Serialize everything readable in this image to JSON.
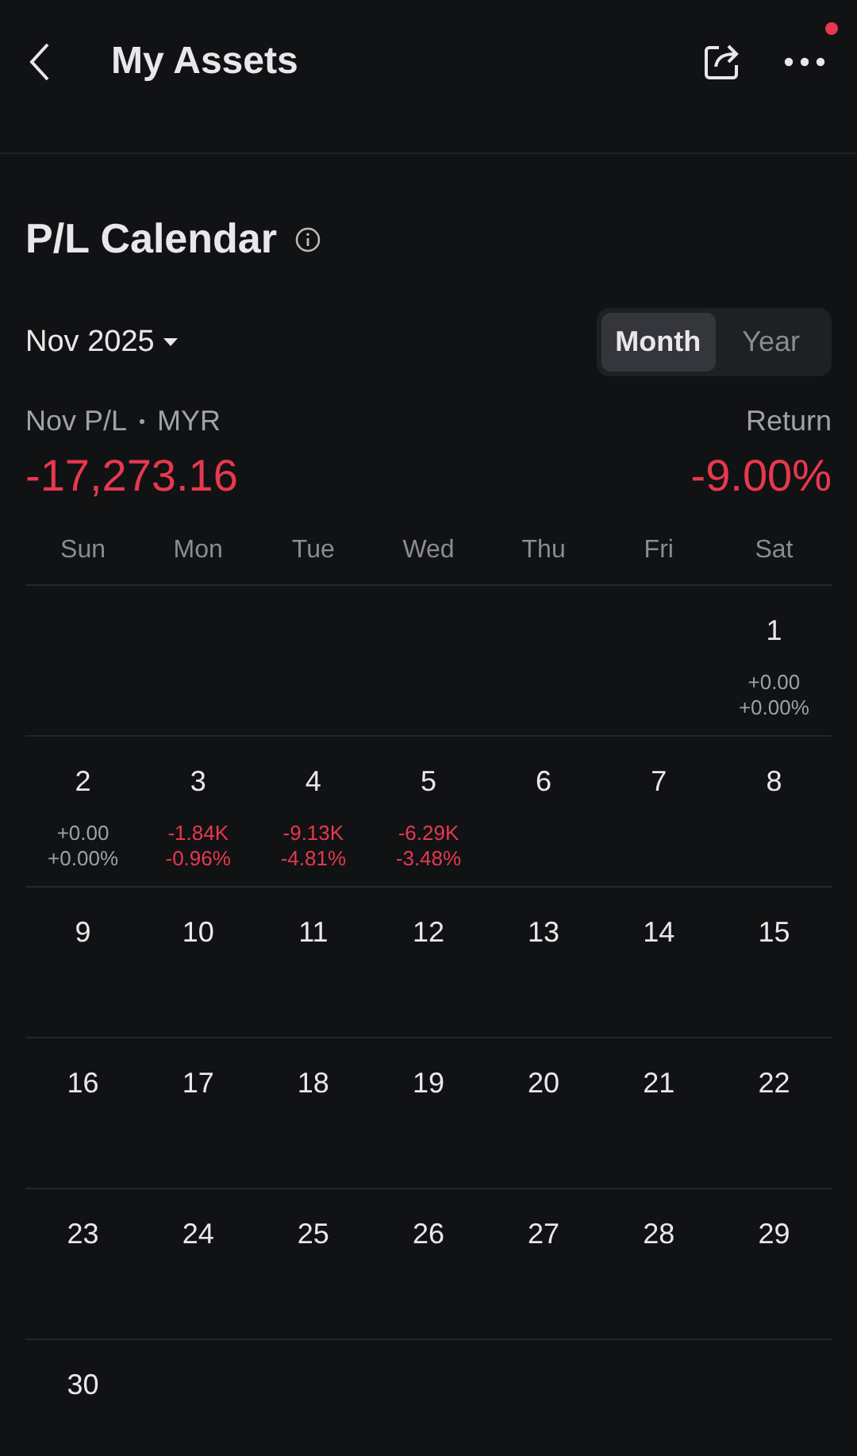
{
  "header": {
    "title": "My Assets",
    "notification_dot": true
  },
  "section": {
    "title": "P/L Calendar"
  },
  "period": {
    "label": "Nov 2025"
  },
  "tabs": [
    {
      "label": "Month",
      "selected": true
    },
    {
      "label": "Year",
      "selected": false
    }
  ],
  "summary": {
    "pl_label": "Nov P/L",
    "currency": "MYR",
    "pl_value": "-17,273.16",
    "return_label": "Return",
    "return_value": "-9.00%"
  },
  "weekdays": [
    "Sun",
    "Mon",
    "Tue",
    "Wed",
    "Thu",
    "Fri",
    "Sat"
  ],
  "weeks": [
    [
      {
        "kind": "empty"
      },
      {
        "kind": "empty"
      },
      {
        "kind": "empty"
      },
      {
        "kind": "empty"
      },
      {
        "kind": "empty"
      },
      {
        "kind": "empty"
      },
      {
        "kind": "flat",
        "day": "1",
        "pl": "+0.00",
        "pct": "+0.00%"
      }
    ],
    [
      {
        "kind": "flat",
        "day": "2",
        "pl": "+0.00",
        "pct": "+0.00%"
      },
      {
        "kind": "loss",
        "day": "3",
        "pl": "-1.84K",
        "pct": "-0.96%"
      },
      {
        "kind": "loss",
        "day": "4",
        "pl": "-9.13K",
        "pct": "-4.81%"
      },
      {
        "kind": "loss",
        "day": "5",
        "pl": "-6.29K",
        "pct": "-3.48%"
      },
      {
        "kind": "day",
        "day": "6"
      },
      {
        "kind": "day",
        "day": "7"
      },
      {
        "kind": "day",
        "day": "8"
      }
    ],
    [
      {
        "kind": "day",
        "day": "9"
      },
      {
        "kind": "day",
        "day": "10"
      },
      {
        "kind": "day",
        "day": "11"
      },
      {
        "kind": "day",
        "day": "12"
      },
      {
        "kind": "day",
        "day": "13"
      },
      {
        "kind": "day",
        "day": "14"
      },
      {
        "kind": "day",
        "day": "15"
      }
    ],
    [
      {
        "kind": "day",
        "day": "16"
      },
      {
        "kind": "day",
        "day": "17"
      },
      {
        "kind": "day",
        "day": "18"
      },
      {
        "kind": "day",
        "day": "19"
      },
      {
        "kind": "day",
        "day": "20"
      },
      {
        "kind": "day",
        "day": "21"
      },
      {
        "kind": "day",
        "day": "22"
      }
    ],
    [
      {
        "kind": "day",
        "day": "23"
      },
      {
        "kind": "day",
        "day": "24"
      },
      {
        "kind": "day",
        "day": "25"
      },
      {
        "kind": "day",
        "day": "26"
      },
      {
        "kind": "day",
        "day": "27"
      },
      {
        "kind": "day",
        "day": "28"
      },
      {
        "kind": "day",
        "day": "29"
      }
    ],
    [
      {
        "kind": "day",
        "day": "30"
      },
      {
        "kind": "empty"
      },
      {
        "kind": "empty"
      },
      {
        "kind": "empty"
      },
      {
        "kind": "empty"
      },
      {
        "kind": "empty"
      },
      {
        "kind": "empty"
      }
    ]
  ]
}
